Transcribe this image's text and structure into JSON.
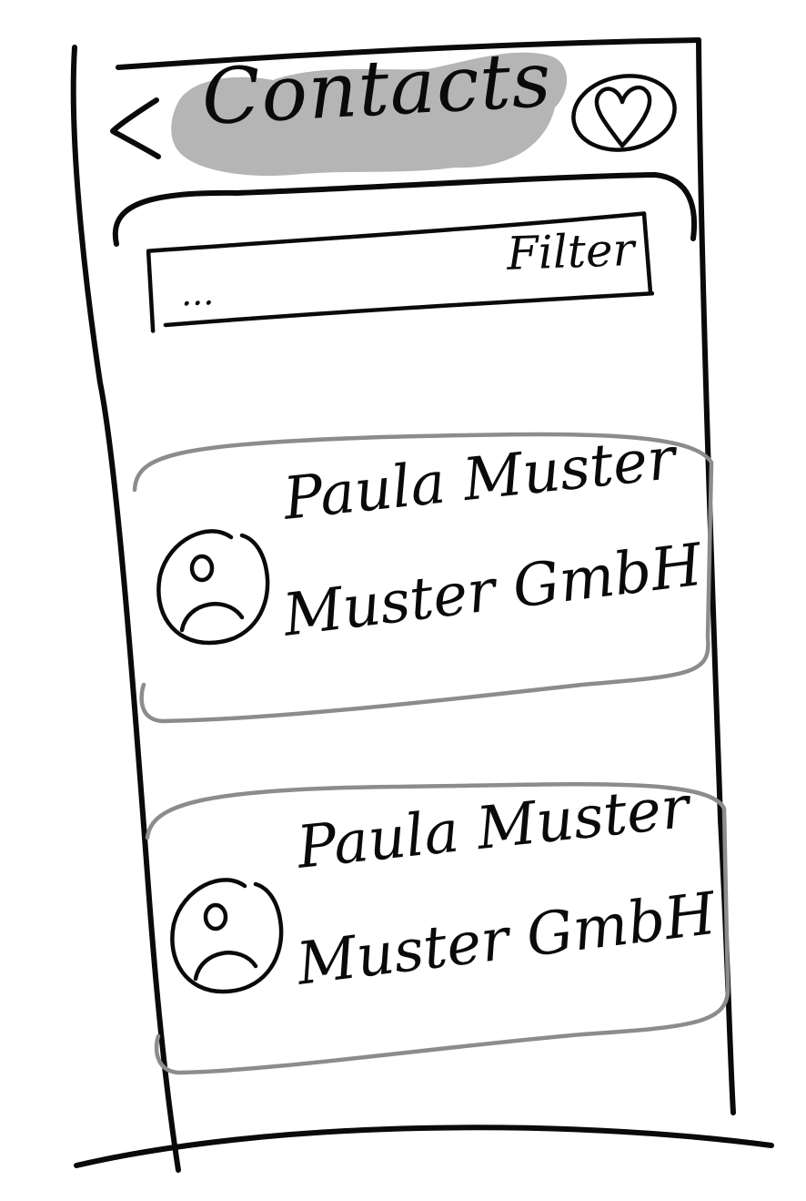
{
  "header": {
    "title": "Contacts",
    "back_icon": "chevron-left-icon",
    "favorite_icon": "heart-icon"
  },
  "filter": {
    "label": "Filter",
    "value": "..."
  },
  "contacts": [
    {
      "name": "Paula Muster",
      "company": "Muster GmbH",
      "avatar_icon": "user-avatar-icon"
    },
    {
      "name": "Paula Muster",
      "company": "Muster GmbH",
      "avatar_icon": "user-avatar-icon"
    }
  ],
  "colors": {
    "ink": "#0a0a0a",
    "title_highlight": "#b5b5b5",
    "card_outline": "#8c8c8c",
    "background": "#ffffff"
  }
}
